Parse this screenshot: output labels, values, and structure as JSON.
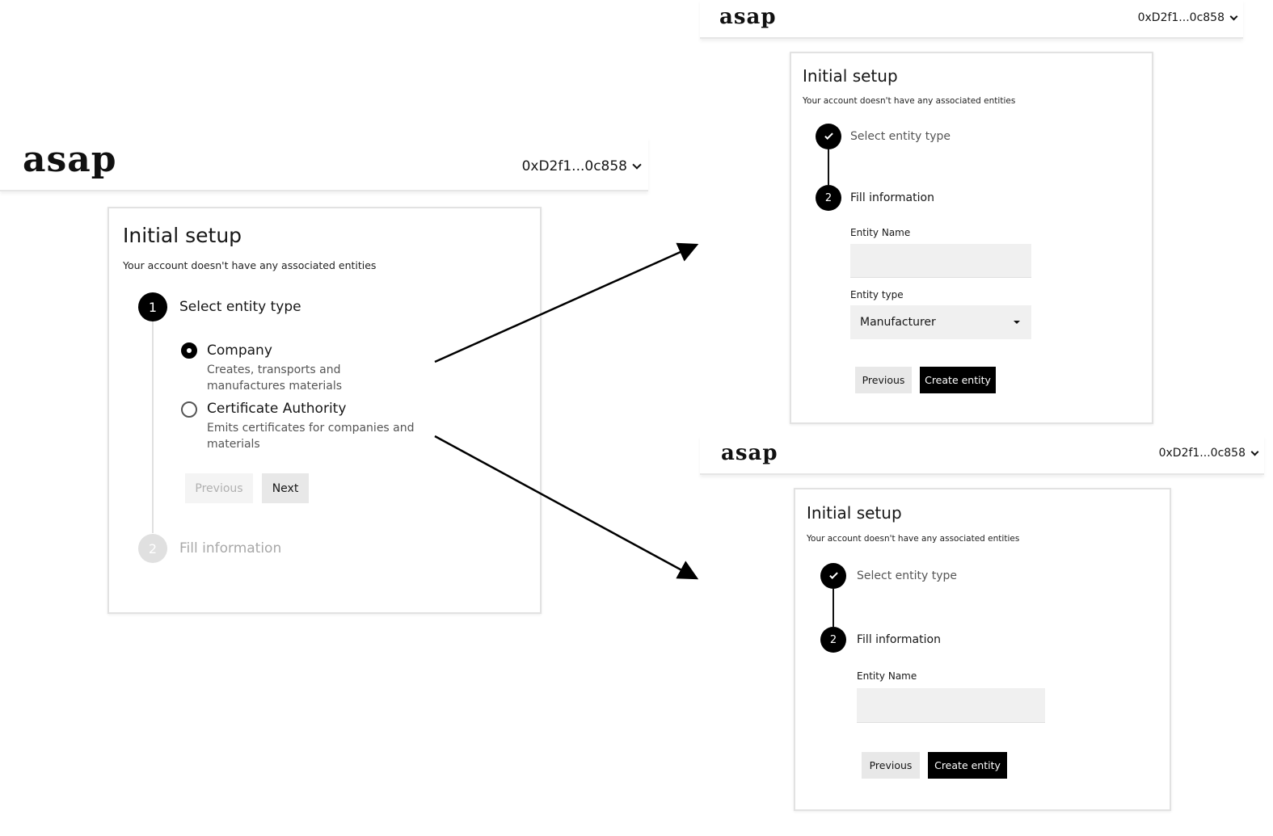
{
  "left": {
    "logo": "asap",
    "account": "0xD2f1...0c858",
    "title": "Initial setup",
    "subtitle": "Your account doesn't have any associated entities",
    "step1": {
      "number": "1",
      "label": "Select entity type"
    },
    "options": [
      {
        "title": "Company",
        "description": "Creates, transports and manufactures materials",
        "selected": true
      },
      {
        "title": "Certificate Authority",
        "description": "Emits certificates for companies and materials",
        "selected": false
      }
    ],
    "previous_label": "Previous",
    "next_label": "Next",
    "step2": {
      "number": "2",
      "label": "Fill information"
    }
  },
  "top_right": {
    "logo": "asap",
    "account": "0xD2f1...0c858",
    "title": "Initial setup",
    "subtitle": "Your account doesn't have any associated entities",
    "step1_label": "Select entity type",
    "step2": {
      "number": "2",
      "label": "Fill information"
    },
    "entity_name_label": "Entity Name",
    "entity_name_value": "",
    "entity_type_label": "Entity type",
    "entity_type_value": "Manufacturer",
    "previous_label": "Previous",
    "create_label": "Create entity"
  },
  "bottom_right": {
    "logo": "asap",
    "account": "0xD2f1...0c858",
    "title": "Initial setup",
    "subtitle": "Your account doesn't have any associated entities",
    "step1_label": "Select entity type",
    "step2": {
      "number": "2",
      "label": "Fill information"
    },
    "entity_name_label": "Entity Name",
    "entity_name_value": "",
    "previous_label": "Previous",
    "create_label": "Create entity"
  },
  "colors": {
    "primary": "#000000",
    "field_bg": "#f0f0f0",
    "disabled": "#e0e0e0",
    "border": "#e2e2e2"
  }
}
